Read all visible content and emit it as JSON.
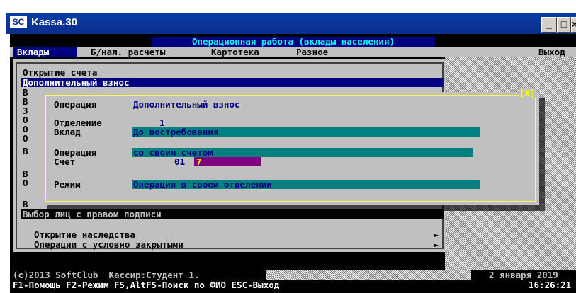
{
  "window": {
    "app_icon": "SC",
    "title": "Kassa.30",
    "min_label": "_",
    "max_label": "□",
    "close_label": "×"
  },
  "header": {
    "title": "Операционная работа (вклады населения)"
  },
  "menu": {
    "items": [
      "Вклады",
      "Б/нал. расчеты",
      "Картотека",
      "Разное"
    ],
    "exit": "Выход"
  },
  "submenu": {
    "items": [
      {
        "label": "Открытие счета",
        "selected": false
      },
      {
        "label": "Дополнительный взнос",
        "selected": true
      }
    ],
    "hidden_letters": [
      "В",
      "В",
      "З",
      "О",
      "О",
      "О",
      "В",
      "В",
      "О",
      "В"
    ],
    "row_select_signers": "Выбор лиц с правом подписи",
    "inheritance": "Открытие наследства",
    "conditional": "Операции с условно закрытыми",
    "arrow": "►"
  },
  "dialog": {
    "close_label": "[X]",
    "operation_label": "Операция",
    "operation_value": "Дополнительный взнос",
    "branch_label": "Отделение",
    "branch_value": "1",
    "deposit_label": "Вклад",
    "deposit_value": "До востребования",
    "operation2_label": "Операция",
    "operation2_value": "со своим счетом",
    "account_label": "Счет",
    "account_prefix": "01",
    "account_value": "7",
    "mode_label": "Режим",
    "mode_value": "Операция в своем отделении"
  },
  "status": {
    "copyright": "(c)2013 SoftClub  Кассир:Студент 1.",
    "date": "2 января 2019",
    "hotkeys": "F1-Помощь F2-Режим F5,AltF5-Поиск по ФИО ESC-Выход",
    "time": "16:26:21"
  },
  "colors": {
    "title_bar": "#0a2f8c",
    "console_bg": "#000000",
    "menu_bg": "#c0c0c0",
    "selection": "#000080",
    "field": "#008080",
    "dialog_border": "#ffff55",
    "cursor": "#800080"
  }
}
